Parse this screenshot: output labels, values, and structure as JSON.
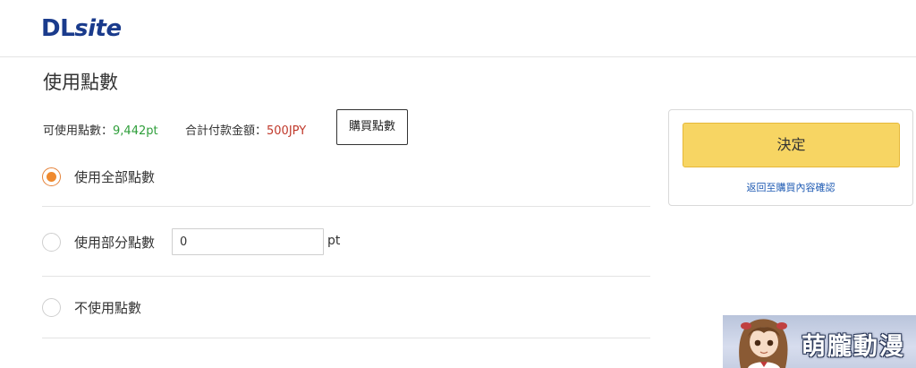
{
  "header": {
    "logo_text_a": "DL",
    "logo_text_b": "site"
  },
  "page_title": "使用點數",
  "points_info": {
    "available_label": "可使用點數：",
    "available_value": "9,442pt",
    "total_label": "合計付款金額：",
    "total_value": "500JPY"
  },
  "buy_points_label": "購買點數",
  "options": [
    {
      "label": "使用全部點數",
      "checked": true
    },
    {
      "label": "使用部分點數",
      "checked": false
    },
    {
      "label": "不使用點數",
      "checked": false
    }
  ],
  "partial_points": {
    "value": "0",
    "unit": "pt"
  },
  "side_panel": {
    "confirm_label": "決定",
    "back_link": "返回至購買內容確認"
  },
  "watermark": {
    "text": "萌朧動漫"
  },
  "colors": {
    "brand": "#1a3b8c",
    "accent_orange": "#ef8a2f",
    "confirm_yellow": "#f7d563",
    "available_green": "#2e9e3a",
    "total_red": "#c0392b",
    "link_blue": "#1f5bb3"
  }
}
